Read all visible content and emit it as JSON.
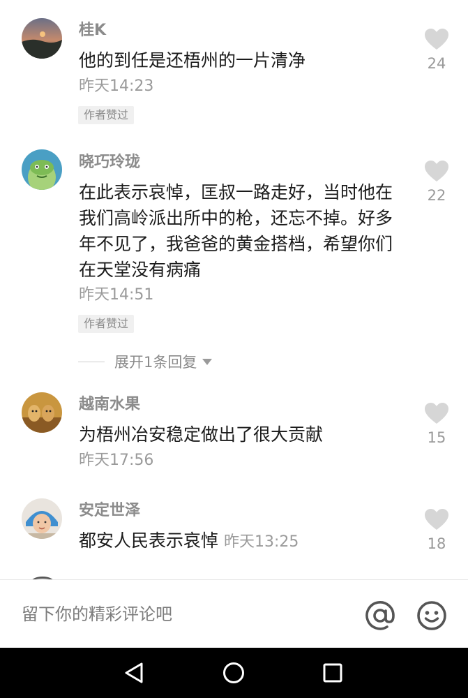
{
  "comments": [
    {
      "username": "桂K",
      "text": "他的到任是还梧州的一片清净",
      "time": "昨天14:23",
      "author_liked": "作者赞过",
      "likes": "24",
      "avatar": "sunset-landscape"
    },
    {
      "username": "晓巧玲珑",
      "text": "在此表示哀悼，匡叔一路走好，当时他在我们高岭派出所中的枪，还忘不掉。好多年不见了，我爸爸的黄金搭档，希望你们在天堂没有病痛",
      "time": "昨天14:51",
      "author_liked": "作者赞过",
      "likes": "22",
      "avatar": "green-cartoon-face",
      "expand_replies": "展开1条回复"
    },
    {
      "username": "越南水果",
      "text": "为梧州冶安稳定做出了很大贡献",
      "time": "昨天17:56",
      "likes": "15",
      "avatar": "dogs-photo"
    },
    {
      "username": "安定世泽",
      "text": "都安人民表示哀悼",
      "time": "昨天13:25",
      "likes": "18",
      "avatar": "child-portrait"
    }
  ],
  "input": {
    "placeholder": "留下你的精彩评论吧",
    "at_icon": "at-icon",
    "emoji_icon": "emoji-icon"
  },
  "navbar": {
    "icons": [
      "back-triangle-icon",
      "home-circle-icon",
      "recents-square-icon"
    ]
  },
  "colors": {
    "username": "#8b8b8b",
    "text": "#1b1b1b",
    "meta": "#9a9a9a",
    "heart": "#d6d6d6",
    "badge_bg": "#f0f0f0",
    "navbar": "#000000"
  }
}
